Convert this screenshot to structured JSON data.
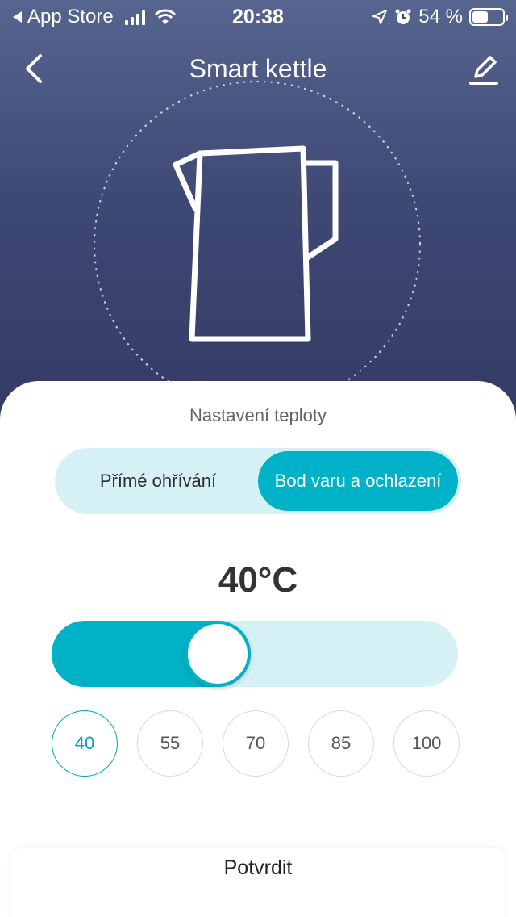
{
  "status_bar": {
    "back_app": "App Store",
    "time": "20:38",
    "battery": "54 %",
    "battery_level": 0.54
  },
  "nav": {
    "title": "Smart kettle",
    "back_icon": "chevron-left-icon",
    "edit_icon": "pencil-icon"
  },
  "temperature_settings": {
    "section_title": "Nastavení teploty",
    "modes": [
      {
        "label": "Přímé ohřívání",
        "selected": false
      },
      {
        "label": "Bod varu a ochlazení",
        "selected": true
      }
    ],
    "current_value": "40°C",
    "slider_min": 40,
    "slider_max": 100,
    "slider_value": 40,
    "slider_fill_fraction": 0.49,
    "presets": [
      "40",
      "55",
      "70",
      "85",
      "100"
    ],
    "active_preset": "40"
  },
  "confirm": {
    "label": "Potvrdit"
  },
  "colors": {
    "accent": "#00b2c8",
    "accent_light": "#d6f1f6",
    "header_top": "#56658f",
    "header_bottom": "#323a63"
  }
}
